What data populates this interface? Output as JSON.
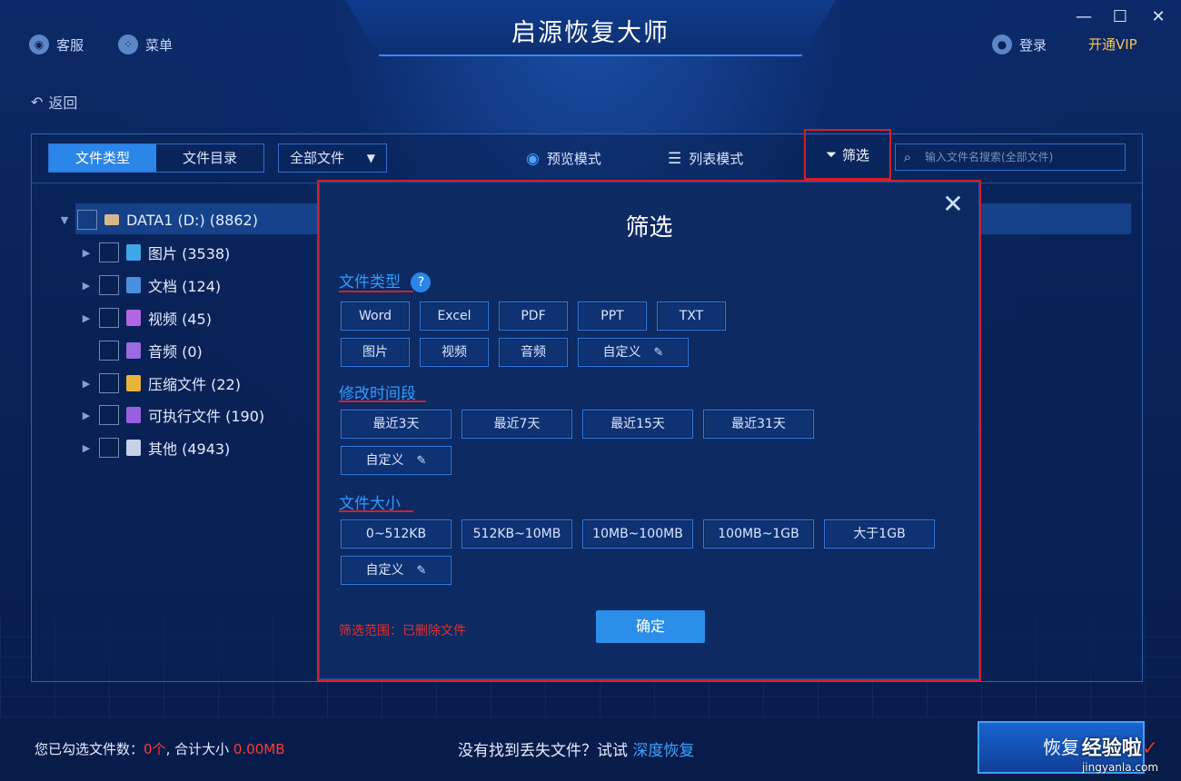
{
  "app": {
    "title": "启源恢复大师"
  },
  "titlebar": {
    "service": "客服",
    "menu": "菜单",
    "login": "登录",
    "vip": "开通VIP",
    "minimize_glyph": "—",
    "maximize_glyph": "☐",
    "close_glyph": "✕"
  },
  "back_label": "返回",
  "toolbar": {
    "tab_file_type": "文件类型",
    "tab_file_dir": "文件目录",
    "dropdown_value": "全部文件",
    "preview_mode": "预览模式",
    "list_mode": "列表模式",
    "filter": "筛选",
    "search_placeholder": "输入文件名搜索(全部文件)"
  },
  "tree": {
    "root": "DATA1 (D:) (8862)",
    "items": [
      {
        "label": "图片 (3538)",
        "color": "#3fa6e8"
      },
      {
        "label": "文档 (124)",
        "color": "#4a8fe0"
      },
      {
        "label": "视频 (45)",
        "color": "#b267e0"
      },
      {
        "label": "音频 (0)",
        "color": "#9a6ae0"
      },
      {
        "label": "压缩文件 (22)",
        "color": "#e8b43a"
      },
      {
        "label": "可执行文件 (190)",
        "color": "#9a5ee0"
      },
      {
        "label": "其他 (4943)",
        "color": "#c8d2e4"
      }
    ]
  },
  "modal": {
    "title": "筛选",
    "close_glyph": "✕",
    "section_type": "文件类型",
    "help_glyph": "?",
    "type_chips": [
      "Word",
      "Excel",
      "PDF",
      "PPT",
      "TXT",
      "图片",
      "视频",
      "音频",
      "自定义"
    ],
    "section_time": "修改时间段",
    "time_chips": [
      "最近3天",
      "最近7天",
      "最近15天",
      "最近31天",
      "自定义"
    ],
    "section_size": "文件大小",
    "size_chips": [
      "0~512KB",
      "512KB~10MB",
      "10MB~100MB",
      "100MB~1GB",
      "大于1GB",
      "自定义"
    ],
    "range_label": "筛选范围：已删除文件",
    "ok": "确定"
  },
  "bottom": {
    "selected_prefix": "您已勾选文件数：",
    "selected_count": "0个",
    "selected_mid": ", 合计大小 ",
    "selected_size": "0.00MB",
    "hint": "没有找到丢失文件？试试 ",
    "deep_recover": "深度恢复",
    "recover_button": "恢复"
  },
  "watermark": {
    "text": "经验啦",
    "check": "✓",
    "url": "jingyanla.com"
  }
}
